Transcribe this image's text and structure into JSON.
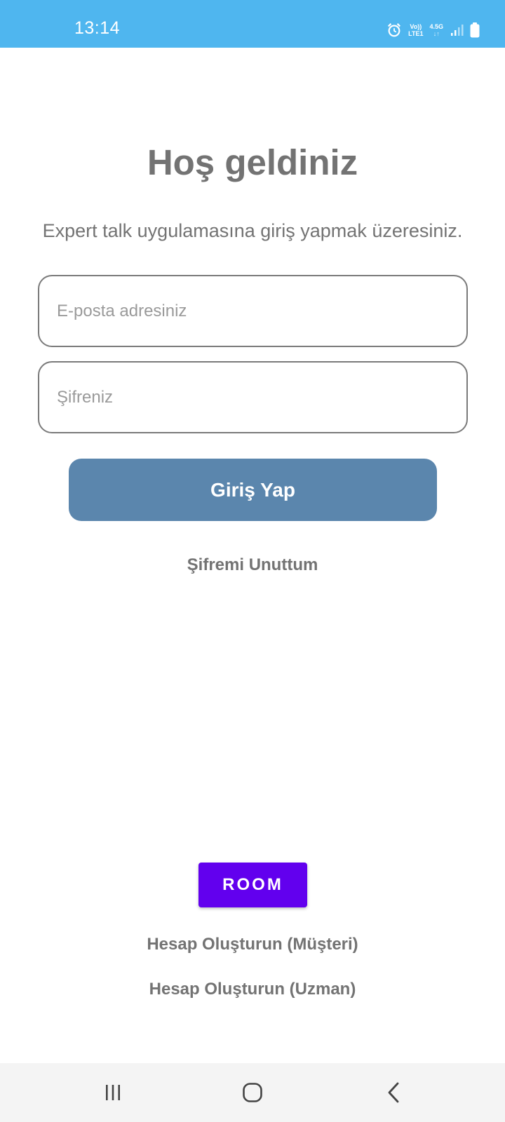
{
  "status_bar": {
    "time": "13:14",
    "volte_line1": "Vo))",
    "volte_line2": "LTE1",
    "network_type": "4.5G",
    "data_arrows": "↓↑",
    "icons": [
      "alarm-icon",
      "signal-icon",
      "battery-icon"
    ],
    "background_color": "#4fb6ef"
  },
  "login": {
    "title": "Hoş geldiniz",
    "subtitle": "Expert talk uygulamasına giriş yapmak üzeresiniz.",
    "email_placeholder": "E-posta adresiniz",
    "email_value": "",
    "password_placeholder": "Şifreniz",
    "password_value": "",
    "login_button": "Giriş Yap",
    "login_button_color": "#5b86ad",
    "forgot_password": "Şifremi Unuttum"
  },
  "footer": {
    "room_button": "ROOM",
    "room_button_color": "#6200ee",
    "create_customer": "Hesap Oluşturun (Müşteri)",
    "create_expert": "Hesap Oluşturun (Uzman)"
  },
  "nav_bar": {
    "icons": [
      "recents-icon",
      "home-icon",
      "back-icon"
    ]
  }
}
